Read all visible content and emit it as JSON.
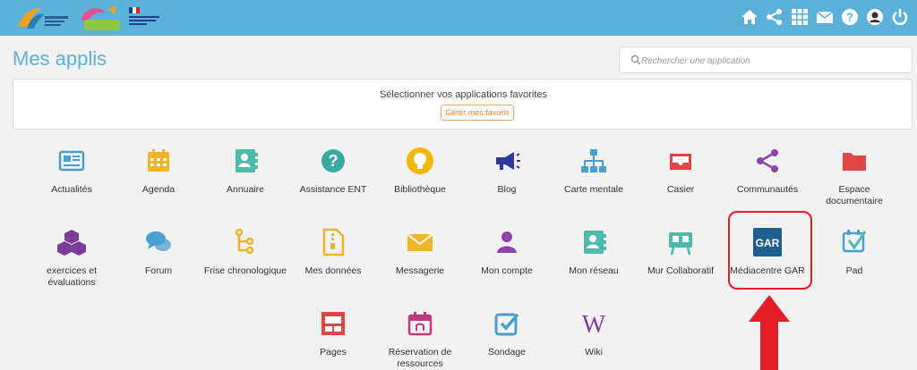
{
  "colors": {
    "accent": "#5bb1d9",
    "highlight": "#e31e24",
    "orange": "#e8823a"
  },
  "header": {
    "logos": [
      "collectivite-logo",
      "gibet-logo",
      "academie-logo"
    ],
    "icons": [
      "home-icon",
      "share-icon",
      "grid-icon",
      "mail-icon",
      "help-icon",
      "user-icon",
      "power-icon"
    ]
  },
  "page": {
    "title": "Mes applis"
  },
  "search": {
    "placeholder": "Rechercher une application"
  },
  "favorites": {
    "title": "Sélectionner vos applications favorites",
    "button": "Gérer mes favoris"
  },
  "apps": [
    {
      "label": "Actualités",
      "icon": "newspaper-icon",
      "color": "#4a9fd0"
    },
    {
      "label": "Agenda",
      "icon": "calendar-icon",
      "color": "#f0b429"
    },
    {
      "label": "Annuaire",
      "icon": "contact-book-icon",
      "color": "#4dbaaa"
    },
    {
      "label": "Assistance ENT",
      "icon": "question-icon",
      "color": "#3aa99f"
    },
    {
      "label": "Bibliothèque",
      "icon": "lightbulb-icon",
      "color": "#f2b705"
    },
    {
      "label": "Blog",
      "icon": "megaphone-icon",
      "color": "#2e3a9e"
    },
    {
      "label": "Carte mentale",
      "icon": "sitemap-icon",
      "color": "#4a9fd0"
    },
    {
      "label": "Casier",
      "icon": "inbox-icon",
      "color": "#e04646"
    },
    {
      "label": "Communautés",
      "icon": "share-nodes-icon",
      "color": "#8e44ad"
    },
    {
      "label": "Espace documentaire",
      "icon": "folder-icon",
      "color": "#e04646"
    },
    {
      "label": "exercices et évaluations",
      "icon": "cubes-icon",
      "color": "#7d3c98"
    },
    {
      "label": "Forum",
      "icon": "chat-icon",
      "color": "#4a9fd0"
    },
    {
      "label": "Frise chronologique",
      "icon": "timeline-icon",
      "color": "#f0b429"
    },
    {
      "label": "Mes données",
      "icon": "zip-file-icon",
      "color": "#f0b429"
    },
    {
      "label": "Messagerie",
      "icon": "envelope-icon",
      "color": "#f0b429"
    },
    {
      "label": "Mon compte",
      "icon": "person-icon",
      "color": "#8e44ad"
    },
    {
      "label": "Mon réseau",
      "icon": "contact-book-icon",
      "color": "#4dbaaa"
    },
    {
      "label": "Mur Collaboratif",
      "icon": "sticky-board-icon",
      "color": "#4dbaaa"
    },
    {
      "label": "Médiacentre GAR",
      "icon": "gar-icon",
      "color": "#1e5f8c",
      "text": "GAR"
    },
    {
      "label": "Pad",
      "icon": "pad-icon",
      "color": "#4a9fd0"
    },
    {
      "label": "Pages",
      "icon": "layout-icon",
      "color": "#e04646"
    },
    {
      "label": "Réservation de ressources",
      "icon": "booking-icon",
      "color": "#c0397a"
    },
    {
      "label": "Sondage",
      "icon": "checkbox-icon",
      "color": "#4a9fd0"
    },
    {
      "label": "Wiki",
      "icon": "wiki-icon",
      "color": "#7d3c98",
      "text": "W"
    }
  ]
}
